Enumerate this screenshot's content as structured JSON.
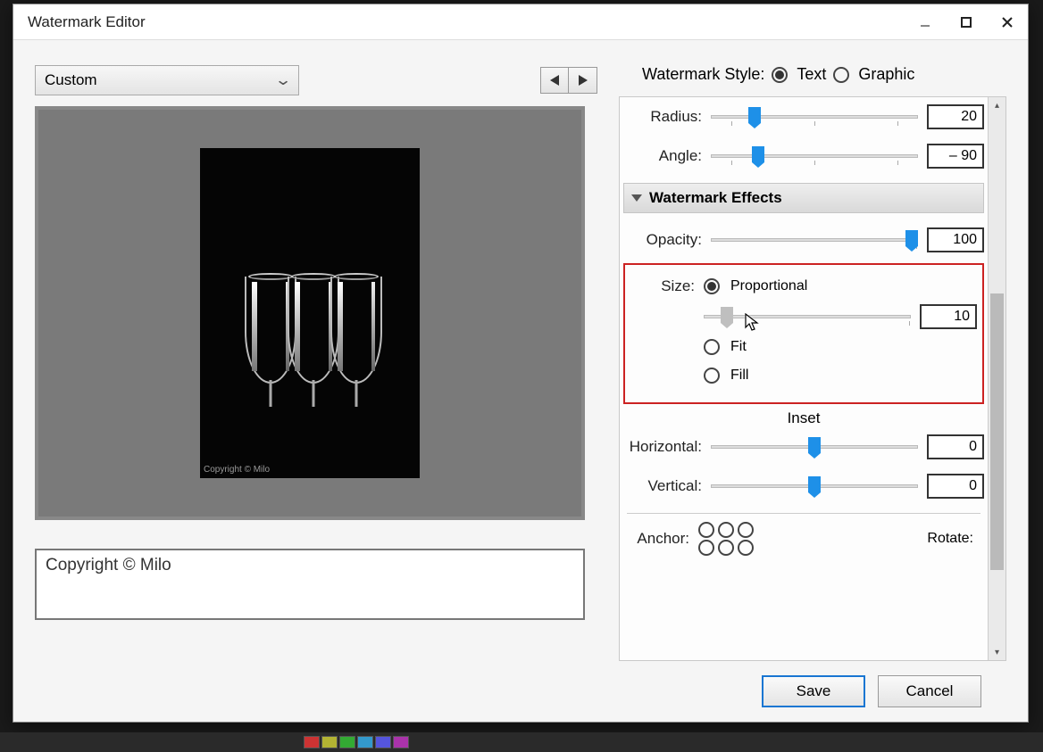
{
  "dialog": {
    "title": "Watermark Editor"
  },
  "preset": {
    "selected": "Custom"
  },
  "style": {
    "label": "Watermark Style:",
    "text_label": "Text",
    "graphic_label": "Graphic",
    "selected": "text"
  },
  "sliders": {
    "radius": {
      "label": "Radius:",
      "value": 20,
      "pos_pct": 18
    },
    "angle": {
      "label": "Angle:",
      "value": "– 90",
      "pos_pct": 20
    },
    "opacity": {
      "label": "Opacity:",
      "value": 100,
      "pos_pct": 100
    },
    "size": {
      "value": 10,
      "pos_pct": 8
    },
    "inset_h": {
      "label": "Horizontal:",
      "value": 0,
      "pos_pct": 50
    },
    "inset_v": {
      "label": "Vertical:",
      "value": 0,
      "pos_pct": 50
    }
  },
  "effects": {
    "header": "Watermark Effects",
    "size_label": "Size:",
    "proportional_label": "Proportional",
    "fit_label": "Fit",
    "fill_label": "Fill",
    "inset_label": "Inset",
    "anchor_label": "Anchor:",
    "rotate_label": "Rotate:"
  },
  "preview": {
    "overlay_text": "Copyright © Milo"
  },
  "watermark_text": "Copyright © Milo",
  "buttons": {
    "save": "Save",
    "cancel": "Cancel"
  }
}
